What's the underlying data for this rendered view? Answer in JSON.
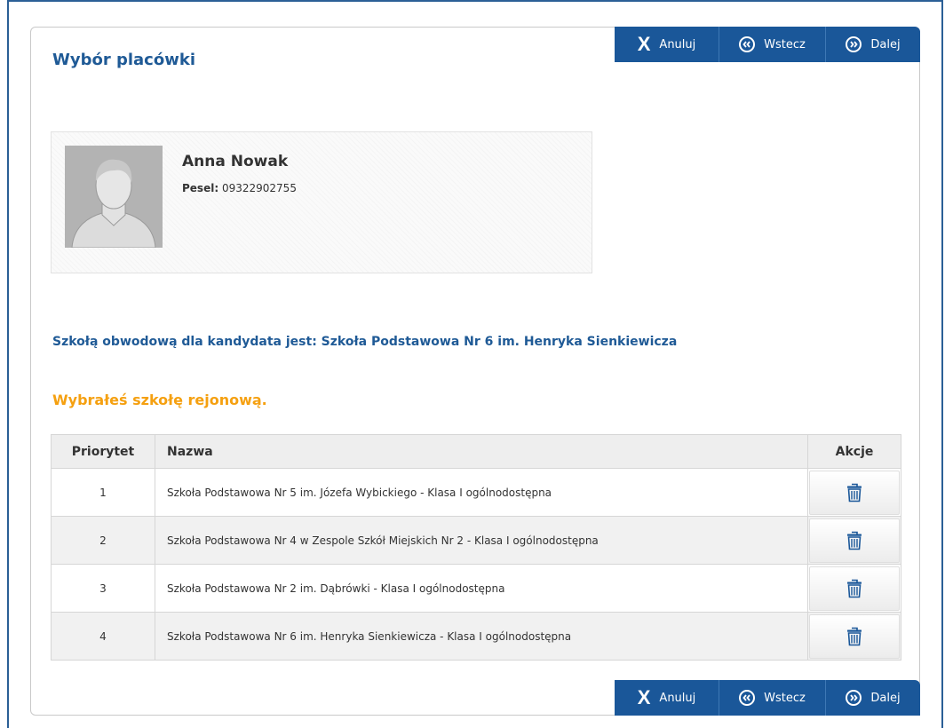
{
  "page": {
    "title": "Wybór placówki"
  },
  "nav": {
    "cancel_label": "Anuluj",
    "back_label": "Wstecz",
    "next_label": "Dalej"
  },
  "candidate": {
    "name": "Anna Nowak",
    "pesel_label": "Pesel:",
    "pesel_value": "09322902755"
  },
  "district_info": "Szkołą obwodową dla kandydata jest: Szkoła Podstawowa Nr 6 im. Henryka Sienkiewicza",
  "chosen_info": "Wybrałeś szkołę rejonową.",
  "table": {
    "headers": {
      "priority": "Priorytet",
      "name": "Nazwa",
      "actions": "Akcje"
    },
    "rows": [
      {
        "priority": "1",
        "name": "Szkoła Podstawowa Nr 5 im. Józefa Wybickiego - Klasa I ogólnodostępna"
      },
      {
        "priority": "2",
        "name": "Szkoła Podstawowa Nr 4 w Zespole Szkół Miejskich Nr 2 - Klasa I ogólnodostępna"
      },
      {
        "priority": "3",
        "name": "Szkoła Podstawowa Nr 2 im. Dąbrówki - Klasa I ogólnodostępna"
      },
      {
        "priority": "4",
        "name": "Szkoła Podstawowa Nr 6 im. Henryka Sienkiewicza - Klasa I ogólnodostępna"
      }
    ]
  },
  "icons": {
    "cancel": "close-icon",
    "back": "circle-chevron-left-icon",
    "next": "circle-chevron-right-icon",
    "delete": "trash-icon",
    "avatar": "user-silhouette-icon"
  },
  "colors": {
    "accent": "#1a5799",
    "title": "#1f5a96",
    "warning": "#f5a010"
  }
}
